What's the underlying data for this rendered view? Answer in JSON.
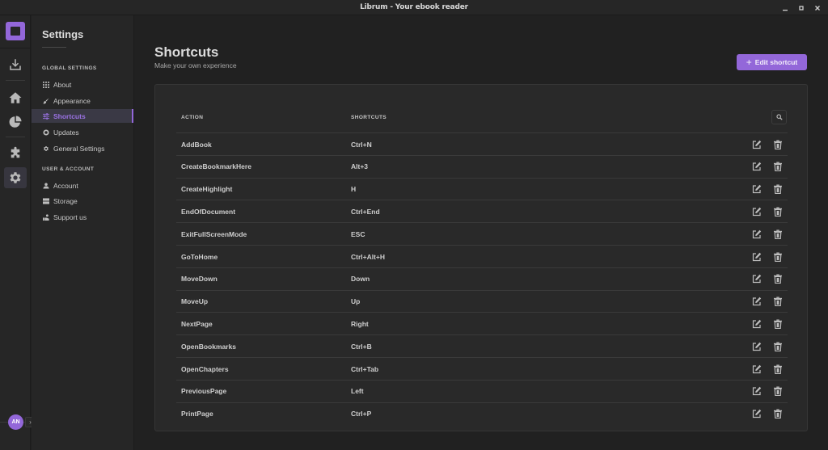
{
  "window": {
    "title": "Librum - Your ebook reader",
    "controls": [
      "minimize",
      "maximize",
      "close"
    ]
  },
  "iconbar": {
    "items": [
      {
        "name": "download",
        "icon": "download-icon",
        "active": false
      },
      {
        "name": "home",
        "icon": "home-icon",
        "active": false
      },
      {
        "name": "statistics",
        "icon": "pie-chart-icon",
        "active": false
      },
      {
        "name": "plugins",
        "icon": "puzzle-icon",
        "active": false
      },
      {
        "name": "settings",
        "icon": "gear-icon",
        "active": true
      }
    ],
    "avatar_initials": "AN",
    "expand_glyph": "›"
  },
  "settings_sidebar": {
    "title": "Settings",
    "sections": [
      {
        "label": "GLOBAL SETTINGS",
        "items": [
          {
            "label": "About",
            "icon": "grid-icon",
            "active": false
          },
          {
            "label": "Appearance",
            "icon": "brush-icon",
            "active": false
          },
          {
            "label": "Shortcuts",
            "icon": "sliders-icon",
            "active": true
          },
          {
            "label": "Updates",
            "icon": "refresh-icon",
            "active": false
          },
          {
            "label": "General Settings",
            "icon": "gear-icon",
            "active": false
          }
        ]
      },
      {
        "label": "USER & ACCOUNT",
        "items": [
          {
            "label": "Account",
            "icon": "user-icon",
            "active": false
          },
          {
            "label": "Storage",
            "icon": "storage-icon",
            "active": false
          },
          {
            "label": "Support us",
            "icon": "hand-heart-icon",
            "active": false
          }
        ]
      }
    ]
  },
  "main": {
    "title": "Shortcuts",
    "subtitle": "Make your own experience",
    "edit_button": {
      "label": "Edit shortcut",
      "icon": "plus-icon"
    },
    "table": {
      "columns": [
        "ACTION",
        "SHORTCUTS"
      ],
      "rows": [
        {
          "action": "AddBook",
          "shortcut": "Ctrl+N"
        },
        {
          "action": "CreateBookmarkHere",
          "shortcut": "Alt+3"
        },
        {
          "action": "CreateHighlight",
          "shortcut": "H"
        },
        {
          "action": "EndOfDocument",
          "shortcut": "Ctrl+End"
        },
        {
          "action": "ExitFullScreenMode",
          "shortcut": "ESC"
        },
        {
          "action": "GoToHome",
          "shortcut": "Ctrl+Alt+H"
        },
        {
          "action": "MoveDown",
          "shortcut": "Down"
        },
        {
          "action": "MoveUp",
          "shortcut": "Up"
        },
        {
          "action": "NextPage",
          "shortcut": "Right"
        },
        {
          "action": "OpenBookmarks",
          "shortcut": "Ctrl+B"
        },
        {
          "action": "OpenChapters",
          "shortcut": "Ctrl+Tab"
        },
        {
          "action": "PreviousPage",
          "shortcut": "Left"
        },
        {
          "action": "PrintPage",
          "shortcut": "Ctrl+P"
        }
      ]
    }
  },
  "colors": {
    "accent": "#9367d9",
    "background": "#212121",
    "panel": "#262626",
    "card": "#292929"
  }
}
